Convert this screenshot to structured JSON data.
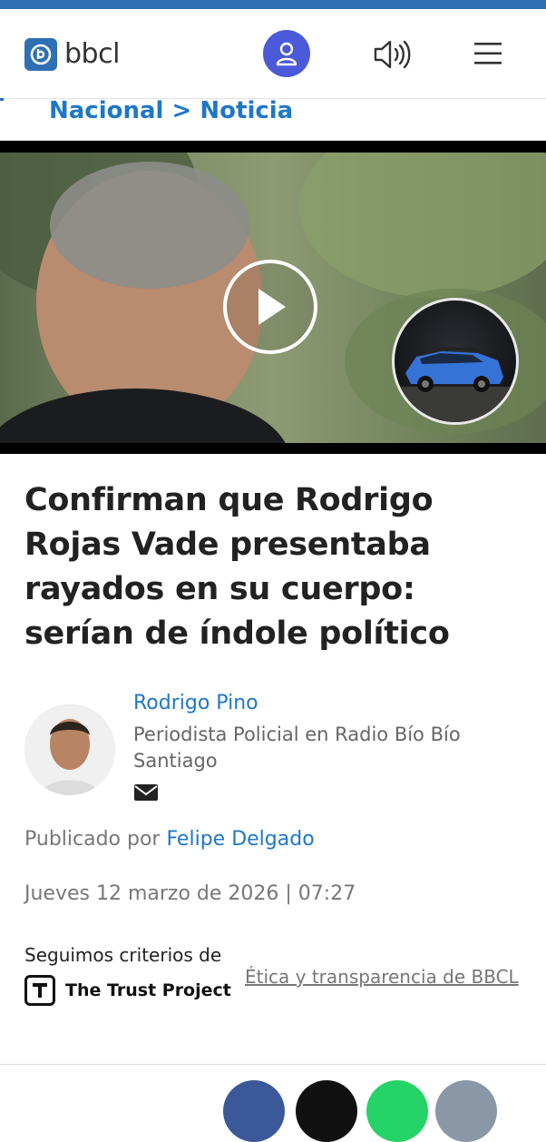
{
  "header": {
    "logo_text": "bbcl",
    "brand_color": "#2f6fb3",
    "account_color": "#4a5ad8"
  },
  "breadcrumb": {
    "section": "Nacional",
    "separator": ">",
    "current": "Noticia"
  },
  "video": {
    "thumbnail_icon": "play-icon"
  },
  "article": {
    "headline": "Confirman que Rodrigo Rojas Vade presentaba rayados en su cuerpo: serían de índole político",
    "author": {
      "name": "Rodrigo Pino",
      "role": "Periodista Policial en Radio Bío Bío Santiago"
    },
    "published_prefix": "Publicado por",
    "editor": "Felipe Delgado",
    "date": "Jueves 12 marzo de 2026 | 07:27",
    "criteria_text": "Seguimos criterios de",
    "trust_project": "The Trust Project",
    "ethics_link": "Ética y transparencia de BBCL"
  },
  "share_colors": [
    "#3b5998",
    "#111111",
    "#25d366",
    "#8a97a6"
  ]
}
